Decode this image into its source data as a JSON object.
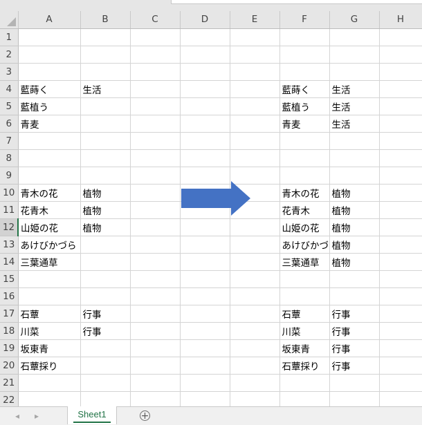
{
  "columns": [
    "A",
    "B",
    "C",
    "D",
    "E",
    "F",
    "G",
    "H"
  ],
  "rows": [
    {
      "num": "1",
      "cells": [
        "",
        "",
        "",
        "",
        "",
        "",
        "",
        ""
      ]
    },
    {
      "num": "2",
      "cells": [
        "",
        "",
        "",
        "",
        "",
        "",
        "",
        ""
      ]
    },
    {
      "num": "3",
      "cells": [
        "",
        "",
        "",
        "",
        "",
        "",
        "",
        ""
      ]
    },
    {
      "num": "4",
      "cells": [
        "藍蒔く",
        "生活",
        "",
        "",
        "",
        "藍蒔く",
        "生活",
        ""
      ]
    },
    {
      "num": "5",
      "cells": [
        "藍植う",
        "",
        "",
        "",
        "",
        "藍植う",
        "生活",
        ""
      ]
    },
    {
      "num": "6",
      "cells": [
        "青麦",
        "",
        "",
        "",
        "",
        "青麦",
        "生活",
        ""
      ]
    },
    {
      "num": "7",
      "cells": [
        "",
        "",
        "",
        "",
        "",
        "",
        "",
        ""
      ]
    },
    {
      "num": "8",
      "cells": [
        "",
        "",
        "",
        "",
        "",
        "",
        "",
        ""
      ]
    },
    {
      "num": "9",
      "cells": [
        "",
        "",
        "",
        "",
        "",
        "",
        "",
        ""
      ]
    },
    {
      "num": "10",
      "cells": [
        "青木の花",
        "植物",
        "",
        "",
        "",
        "青木の花",
        "植物",
        ""
      ]
    },
    {
      "num": "11",
      "cells": [
        "花青木",
        "植物",
        "",
        "",
        "",
        "花青木",
        "植物",
        ""
      ]
    },
    {
      "num": "12",
      "cells": [
        "山姫の花",
        "植物",
        "",
        "",
        "",
        "山姫の花",
        "植物",
        ""
      ]
    },
    {
      "num": "13",
      "cells": [
        "あけびかづら",
        "",
        "",
        "",
        "",
        "あけびかづら",
        "植物",
        ""
      ]
    },
    {
      "num": "14",
      "cells": [
        "三葉通草",
        "",
        "",
        "",
        "",
        "三葉通草",
        "植物",
        ""
      ]
    },
    {
      "num": "15",
      "cells": [
        "",
        "",
        "",
        "",
        "",
        "",
        "",
        ""
      ]
    },
    {
      "num": "16",
      "cells": [
        "",
        "",
        "",
        "",
        "",
        "",
        "",
        ""
      ]
    },
    {
      "num": "17",
      "cells": [
        "石蕈",
        "行事",
        "",
        "",
        "",
        "石蕈",
        "行事",
        ""
      ]
    },
    {
      "num": "18",
      "cells": [
        "川菜",
        "行事",
        "",
        "",
        "",
        "川菜",
        "行事",
        ""
      ]
    },
    {
      "num": "19",
      "cells": [
        "坂東青",
        "",
        "",
        "",
        "",
        "坂東青",
        "行事",
        ""
      ]
    },
    {
      "num": "20",
      "cells": [
        "石蕈採り",
        "",
        "",
        "",
        "",
        "石蕈採り",
        "行事",
        ""
      ]
    },
    {
      "num": "21",
      "cells": [
        "",
        "",
        "",
        "",
        "",
        "",
        "",
        ""
      ]
    },
    {
      "num": "22",
      "cells": [
        "",
        "",
        "",
        "",
        "",
        "",
        "",
        ""
      ]
    }
  ],
  "active_row": "12",
  "sheet_tab": "Sheet1",
  "arrow_color": "#4472c4",
  "accent_color": "#217346",
  "icons": {
    "nav_prev": "triangle-left-icon",
    "nav_next": "triangle-right-icon",
    "add_sheet": "plus-circle-icon",
    "select_all": "select-all-triangle-icon"
  }
}
